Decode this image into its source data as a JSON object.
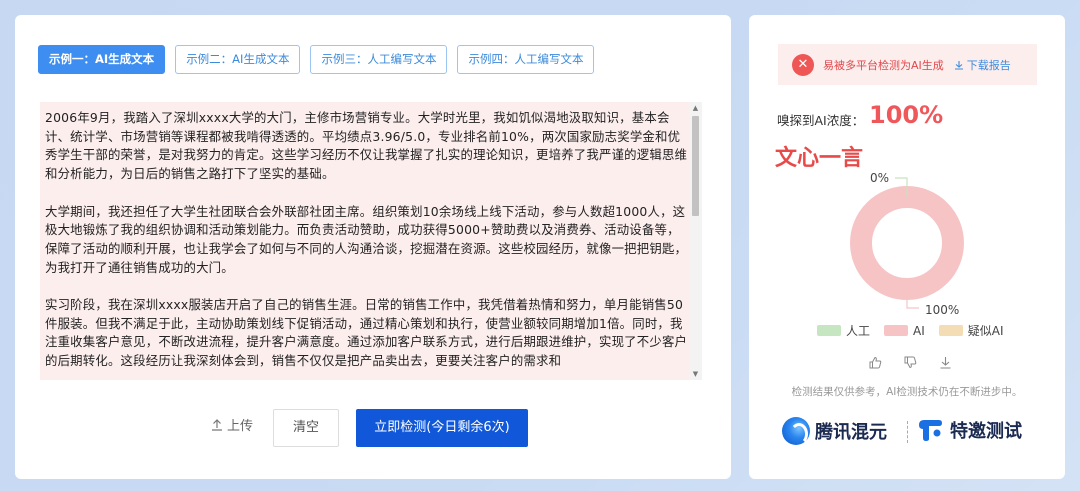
{
  "tabs": [
    {
      "label": "示例一：AI生成文本",
      "active": true
    },
    {
      "label": "示例二：AI生成文本",
      "active": false
    },
    {
      "label": "示例三：人工编写文本",
      "active": false
    },
    {
      "label": "示例四：人工编写文本",
      "active": false
    }
  ],
  "textbox": {
    "paragraphs": [
      "2006年9月，我踏入了深圳xxxx大学的大门，主修市场营销专业。大学时光里，我如饥似渴地汲取知识，基本会计、统计学、市场营销等课程都被我啃得透透的。平均绩点3.96/5.0，专业排名前10%，两次国家励志奖学金和优秀学生干部的荣誉，是对我努力的肯定。这些学习经历不仅让我掌握了扎实的理论知识，更培养了我严谨的逻辑思维和分析能力，为日后的销售之路打下了坚实的基础。",
      "大学期间，我还担任了大学生社团联合会外联部社团主席。组织策划10余场线上线下活动，参与人数超1000人，这极大地锻炼了我的组织协调和活动策划能力。而负责活动赞助，成功获得5000+赞助费以及消费券、活动设备等，保障了活动的顺利开展，也让我学会了如何与不同的人沟通洽谈，挖掘潜在资源。这些校园经历，就像一把把钥匙，为我打开了通往销售成功的大门。",
      "实习阶段，我在深圳xxxx服装店开启了自己的销售生涯。日常的销售工作中，我凭借着热情和努力，单月能销售50件服装。但我不满足于此，主动协助策划线下促销活动，通过精心策划和执行，使营业额较同期增加1倍。同时，我注重收集客户意见，不断改进流程，提升客户满意度。通过添加客户联系方式，进行后期跟进维护，实现了不少客户的后期转化。这段经历让我深刻体会到，销售不仅仅是把产品卖出去，更要关注客户的需求和"
    ]
  },
  "buttons": {
    "upload": "上传",
    "clear": "清空",
    "detect": "立即检测(今日剩余6次)"
  },
  "result": {
    "alert_text": "易被多平台检测为AI生成",
    "download_label": "下载报告",
    "concentration_label": "嗅探到AI浓度：",
    "concentration_value": "100%",
    "model_name": "文心一言",
    "donut_top_label": "0%",
    "donut_bottom_label": "100%",
    "disclaimer": "检测结果仅供参考，AI检测技术仍在不断进步中。"
  },
  "chart_data": {
    "type": "pie",
    "categories": [
      "人工",
      "AI",
      "疑似AI"
    ],
    "values": [
      0,
      100,
      0
    ],
    "colors": [
      "#c5e6c0",
      "#f7c4c6",
      "#f4dcb4"
    ]
  },
  "legend": [
    {
      "label": "人工",
      "color": "#c5e6c0"
    },
    {
      "label": "AI",
      "color": "#f7c4c6"
    },
    {
      "label": "疑似AI",
      "color": "#f4dcb4"
    }
  ],
  "branding": {
    "brand1": "腾讯混元",
    "brand2": "特邀测试"
  },
  "colors": {
    "accent": "#3d8ef0",
    "primary_button": "#1058d9",
    "alert_red": "#ef5757"
  }
}
